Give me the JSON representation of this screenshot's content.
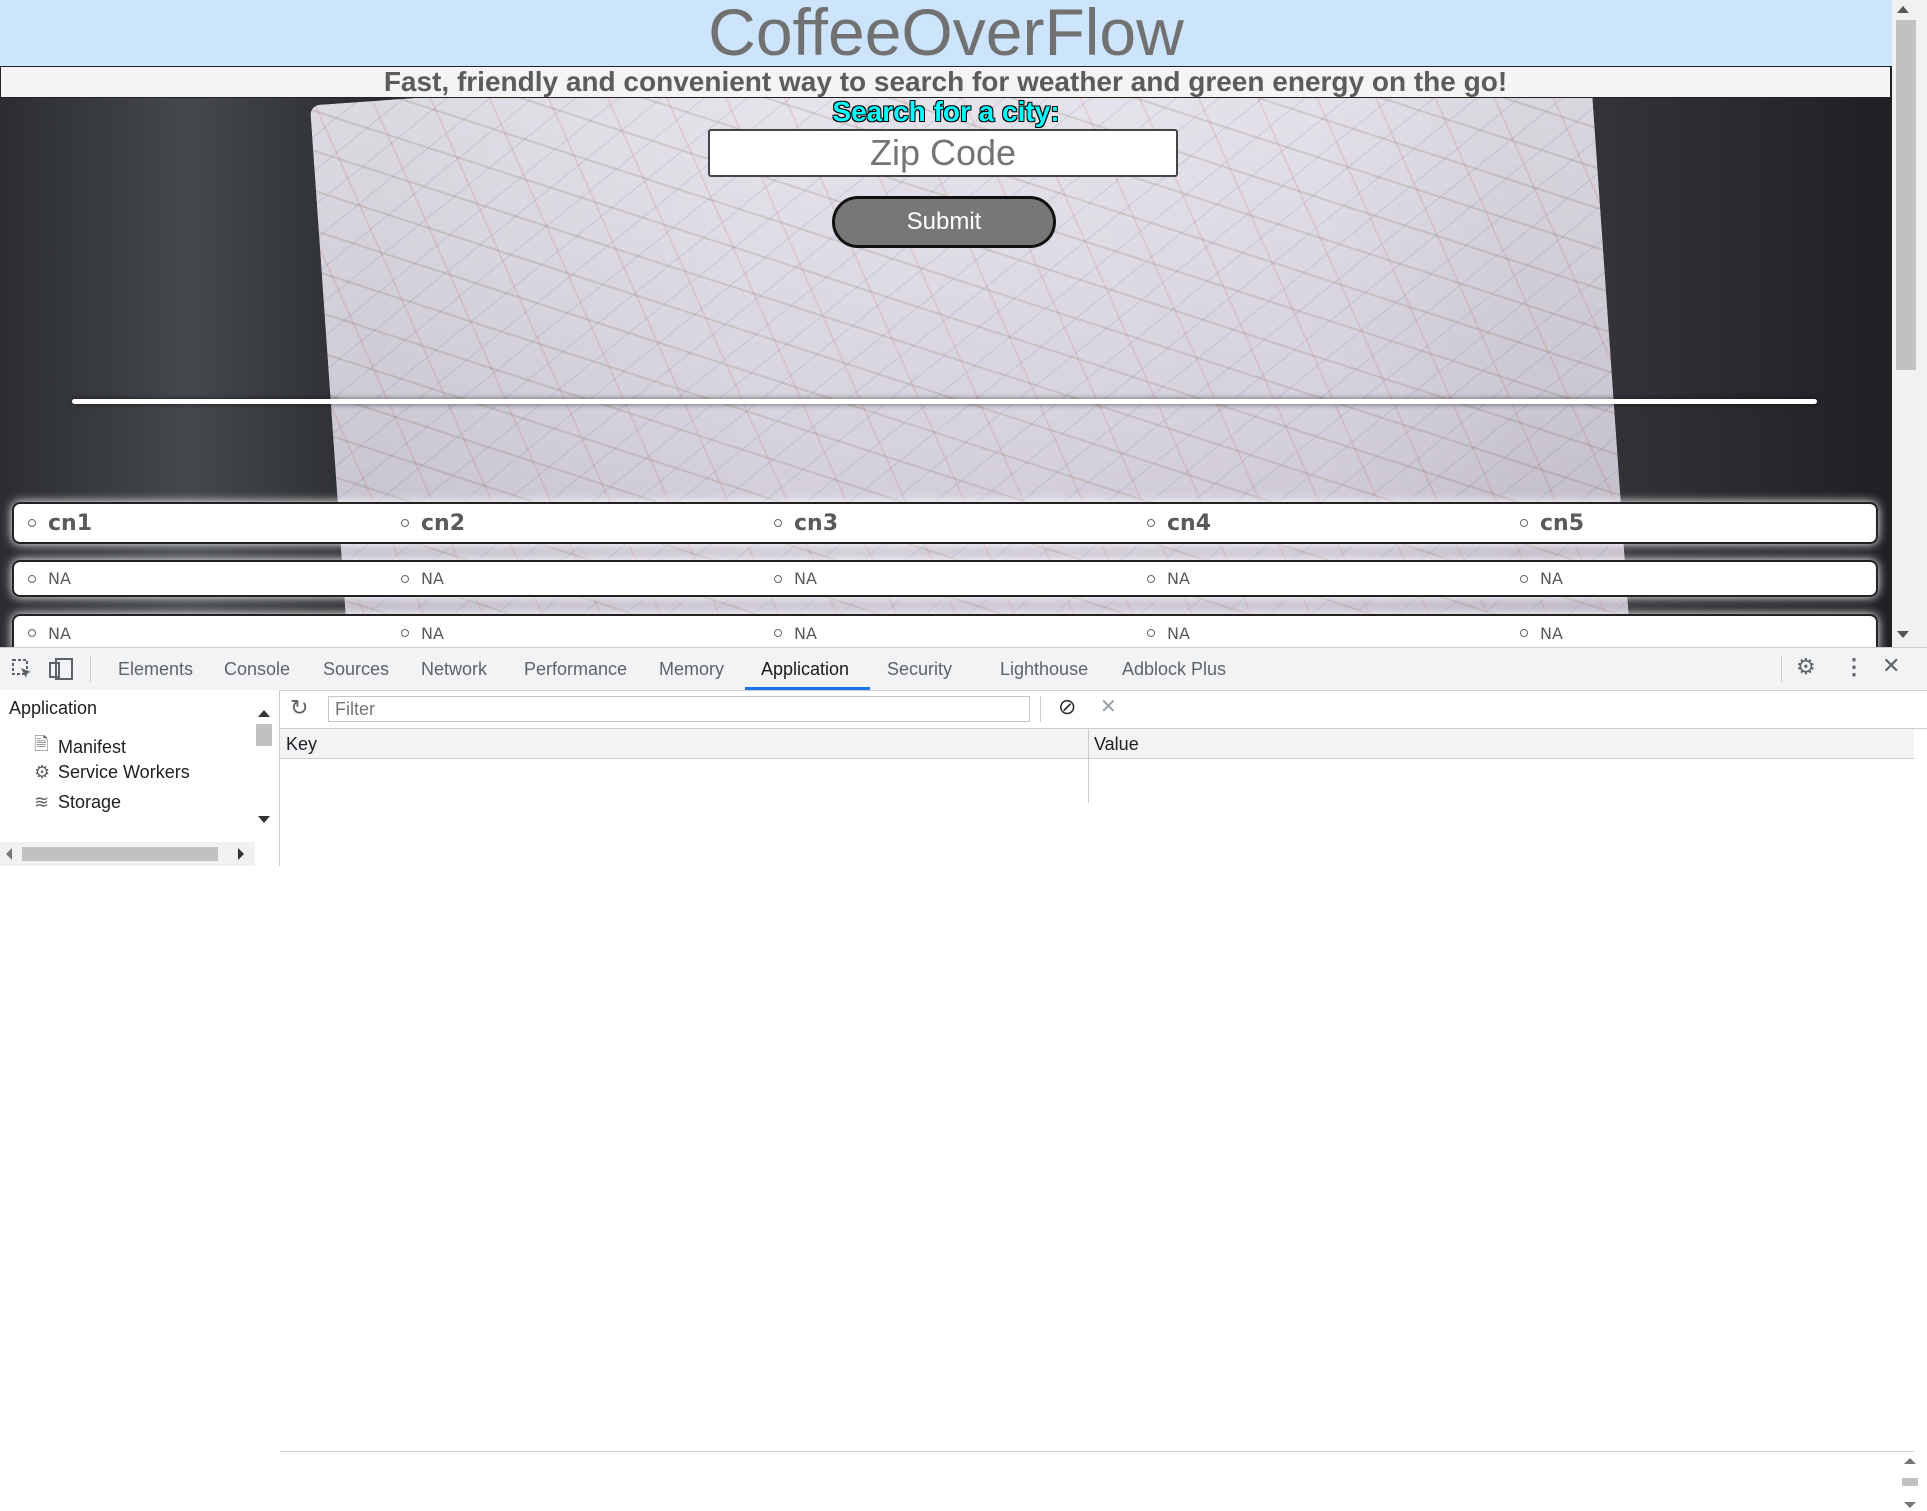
{
  "page": {
    "title": "CoffeeOverFlow",
    "tagline": "Fast, friendly and convenient way to search for weather and green energy on the go!",
    "search_label": "Search for a city:",
    "zip_placeholder": "Zip Code",
    "submit_label": "Submit",
    "city_row": [
      "cn1",
      "cn2",
      "cn3",
      "cn4",
      "cn5"
    ],
    "na_row_1": [
      "NA",
      "NA",
      "NA",
      "NA",
      "NA"
    ],
    "na_row_2": [
      "NA",
      "NA",
      "NA",
      "NA",
      "NA"
    ]
  },
  "devtools": {
    "tabs": [
      "Elements",
      "Console",
      "Sources",
      "Network",
      "Performance",
      "Memory",
      "Application",
      "Security",
      "Lighthouse",
      "Adblock Plus"
    ],
    "active_tab": "Application",
    "sidebar": {
      "title": "Application",
      "items": [
        {
          "label": "Manifest",
          "icon": "file-icon"
        },
        {
          "label": "Service Workers",
          "icon": "gear-icon"
        },
        {
          "label": "Storage",
          "icon": "database-icon"
        }
      ]
    },
    "filter_placeholder": "Filter",
    "table": {
      "key_header": "Key",
      "value_header": "Value"
    }
  },
  "colors": {
    "header_bg": "#cde4fd",
    "search_label": "#00ffff",
    "submit_bg": "#777777",
    "active_tab_underline": "#1a73e8"
  }
}
